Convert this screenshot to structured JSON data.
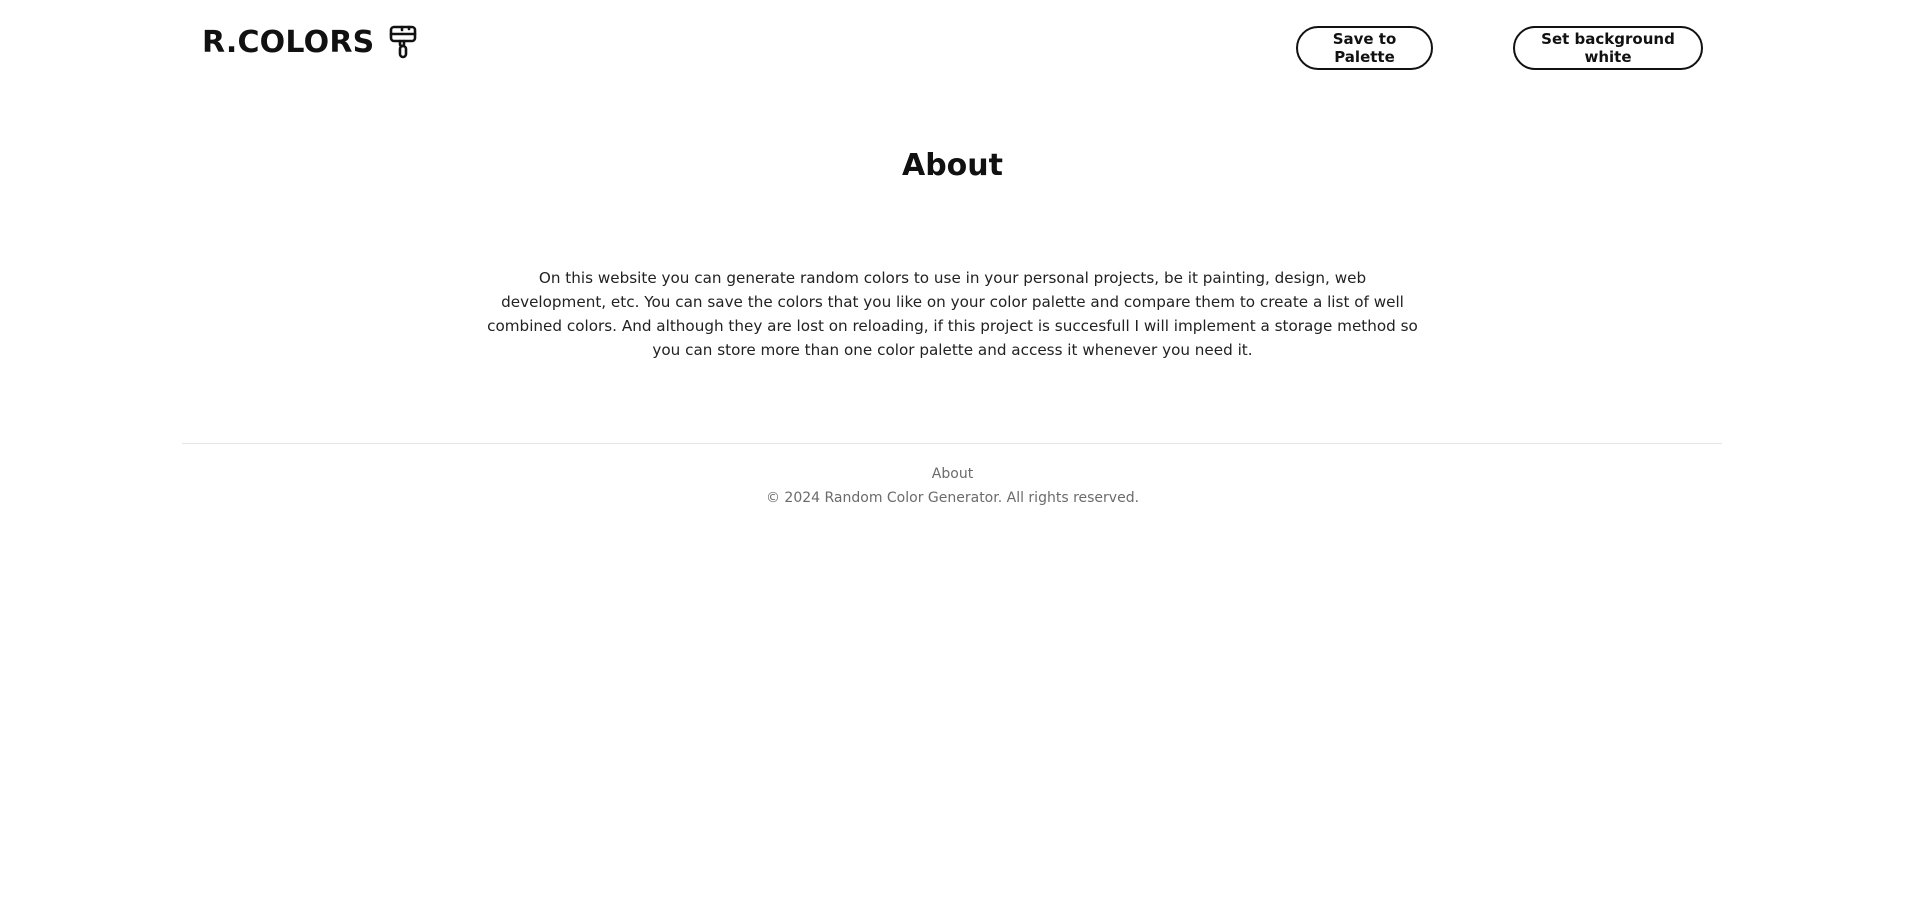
{
  "header": {
    "brand_title": "R.COLORS",
    "brand_icon": "paint-roller-icon",
    "save_button_label": "Save to Palette",
    "background_button_label": "Set background white"
  },
  "main": {
    "title": "About",
    "body": "On this website you can generate random colors to use in your personal projects, be it painting, design, web development, etc. You can save the colors that you like on your color palette and compare them to create a list of well combined colors. And although they are lost on reloading, if this project is succesfull I will implement a storage method so you can store more than one color palette and access it whenever you need it."
  },
  "footer": {
    "link_label": "About",
    "copyright": "© 2024 Random Color Generator. All rights reserved."
  },
  "colors": {
    "text": "#111111",
    "muted": "#6b6b6b",
    "divider": "#e6e6e6",
    "background": "#ffffff"
  }
}
